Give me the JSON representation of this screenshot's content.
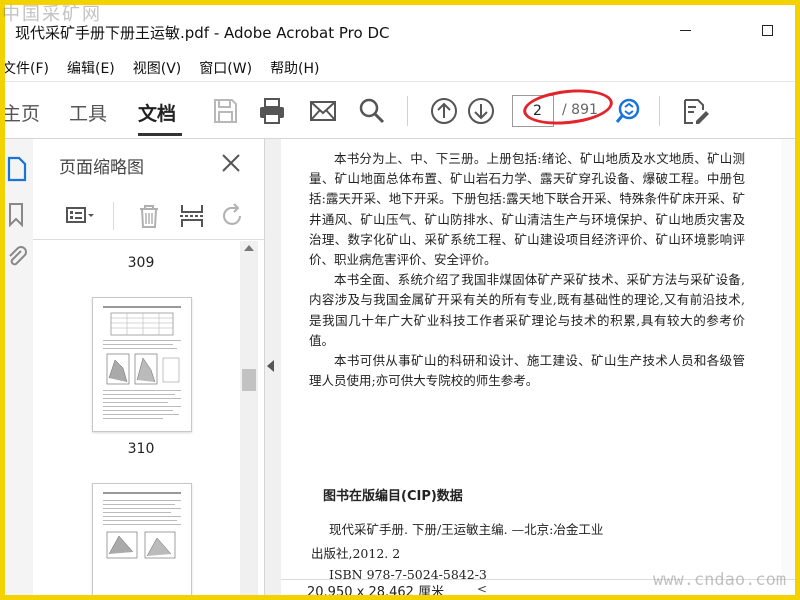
{
  "window": {
    "title": "现代采矿手册下册王运敏.pdf - Adobe Acrobat Pro DC"
  },
  "menu": [
    "文件(F)",
    "编辑(E)",
    "视图(V)",
    "窗口(W)",
    "帮助(H)"
  ],
  "toolbar": {
    "tabs": [
      "主页",
      "工具",
      "文档"
    ],
    "active_tab": "文档",
    "page_current": "2",
    "page_total": "/ 891",
    "icons": [
      "save-icon",
      "print-icon",
      "email-icon",
      "search-icon",
      "page-up-icon",
      "page-down-icon",
      "zoom-icon",
      "edit-pdf-icon"
    ],
    "highlight_color": "#e3242b"
  },
  "left_rail": {
    "icons": [
      "page-thumbnails-icon",
      "bookmark-icon",
      "attachment-icon"
    ]
  },
  "thumbnails": {
    "title": "页面缩略图",
    "pages": [
      "309",
      "310"
    ]
  },
  "document": {
    "paragraphs": [
      "本书分为上、中、下三册。上册包括:绪论、矿山地质及水文地质、矿山测量、矿山地面总体布置、矿山岩石力学、露天矿穿孔设备、爆破工程。中册包括:露天开采、地下开采。下册包括:露天地下联合开采、特殊条件矿床开采、矿井通风、矿山压气、矿山防排水、矿山清洁生产与环境保护、矿山地质灾害及治理、数字化矿山、采矿系统工程、矿山建设项目经济评价、矿山环境影响评价、职业病危害评价、安全评价。",
      "本书全面、系统介绍了我国非煤固体矿产采矿技术、采矿方法与采矿设备,内容涉及与我国金属矿开采有关的所有专业,既有基础性的理论,又有前沿技术,是我国几十年广大矿业科技工作者采矿理论与技术的积累,具有较大的参考价值。",
      "本书可供从事矿山的科研和设计、施工建设、矿山生产技术人员和各级管理人员使用;亦可供大专院校的师生参考。"
    ],
    "cip_title": "图书在版编目(CIP)数据",
    "cip_line1": "现代采矿手册. 下册/王运敏主编. —北京:冶金工业",
    "cip_line2": "出版社,2012. 2",
    "cip_line3": "ISBN 978-7-5024-5842-3"
  },
  "status": {
    "page_size": "20.950 x 28.462 厘米"
  },
  "watermarks": {
    "top": "中国采矿网",
    "bottom": "www.cndao.com"
  },
  "colors": {
    "frame_border": "#f2d200",
    "accent_blue": "#1a73d9"
  }
}
